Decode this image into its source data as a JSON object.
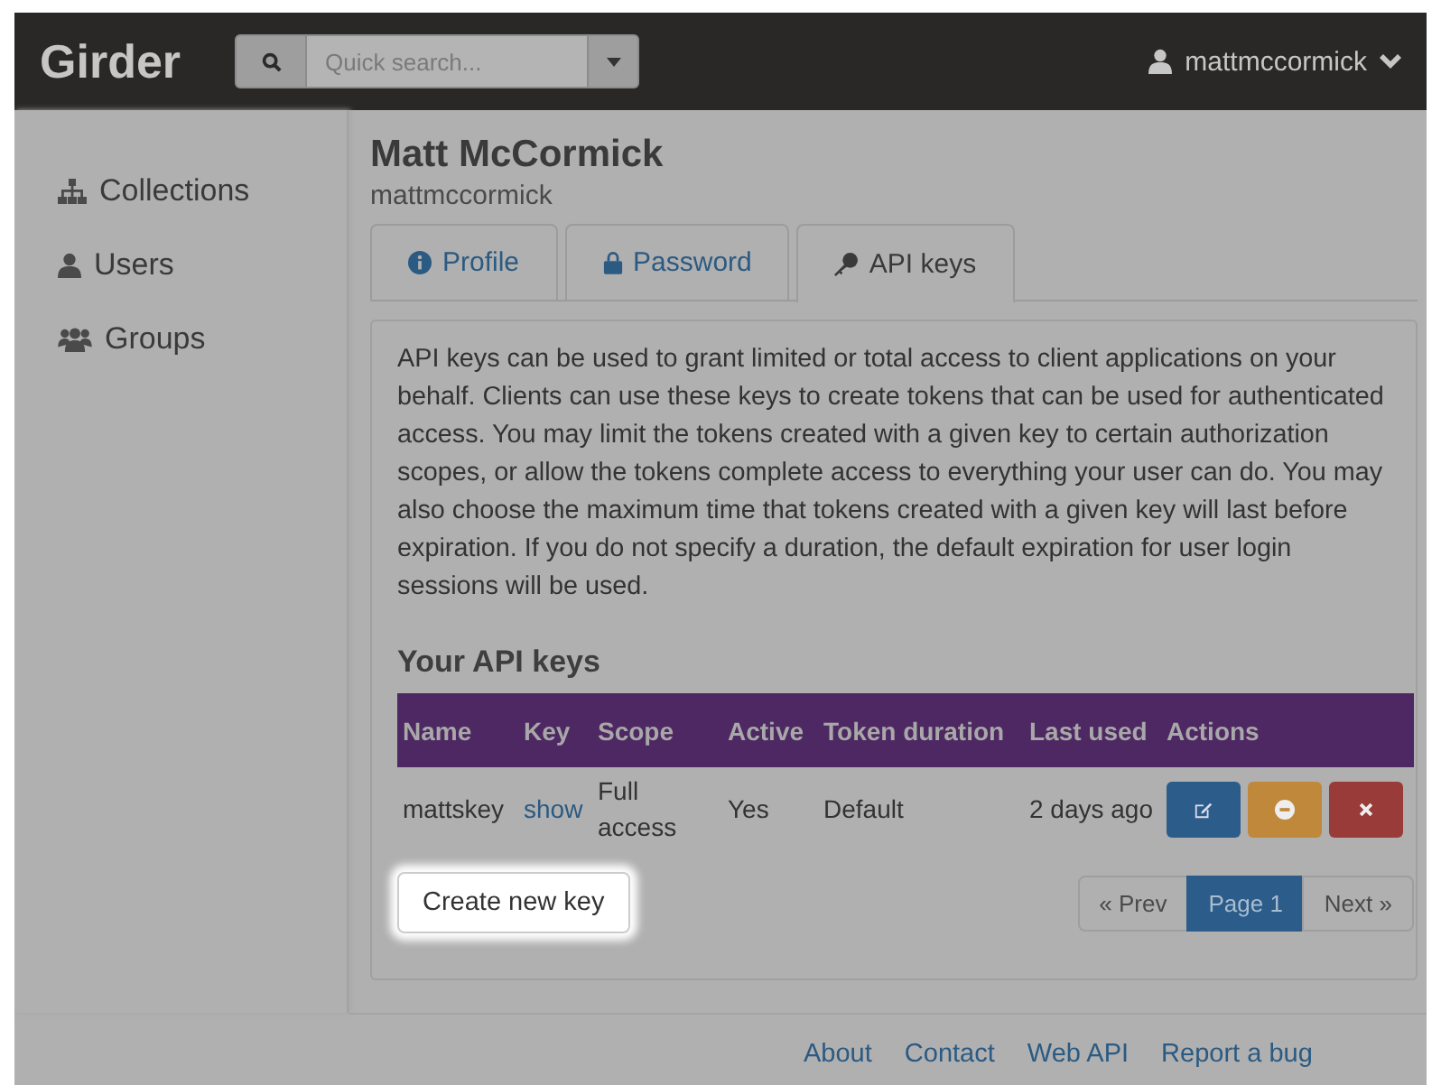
{
  "header": {
    "logo": "Girder",
    "search": {
      "placeholder": "Quick search..."
    },
    "user": "mattmccormick"
  },
  "sidebar": {
    "items": [
      {
        "label": "Collections",
        "kind": "sitemap"
      },
      {
        "label": "Users",
        "kind": "user"
      },
      {
        "label": "Groups",
        "kind": "group"
      }
    ]
  },
  "profile": {
    "name": "Matt McCormick",
    "login": "mattmccormick"
  },
  "tabs": [
    {
      "label": "Profile",
      "kind": "info",
      "selected": false
    },
    {
      "label": "Password",
      "kind": "lock",
      "selected": false
    },
    {
      "label": "API keys",
      "kind": "key",
      "selected": true
    }
  ],
  "description": "API keys can be used to grant limited or total access to client applications on your behalf. Clients can use these keys to create tokens that can be used for authenticated access. You may limit the tokens created with a given key to certain authorization scopes, or allow the tokens complete access to everything your user can do. You may also choose the maximum time that tokens created with a given key will last before expiration. If you do not specify a duration, the default expiration for user login sessions will be used.",
  "keys_heading": "Your API keys",
  "table": {
    "columns": [
      "Name",
      "Key",
      "Scope",
      "Active",
      "Token duration",
      "Last used",
      "Actions"
    ],
    "rows": [
      {
        "name": "mattskey",
        "key_link": "show",
        "scope": "Full access",
        "active": "Yes",
        "duration": "Default",
        "last_used": "2 days ago",
        "actions": [
          {
            "kind": "edit"
          },
          {
            "kind": "deactivate"
          },
          {
            "kind": "delete"
          }
        ]
      }
    ]
  },
  "create_button": {
    "label": "Create new key",
    "highlighted": true
  },
  "pagination": [
    {
      "label": "« Prev",
      "selected": false
    },
    {
      "label": "Page 1",
      "selected": true
    },
    {
      "label": "Next »",
      "selected": false
    }
  ],
  "footer": {
    "links": [
      "About",
      "Contact",
      "Web API",
      "Report a bug"
    ]
  }
}
